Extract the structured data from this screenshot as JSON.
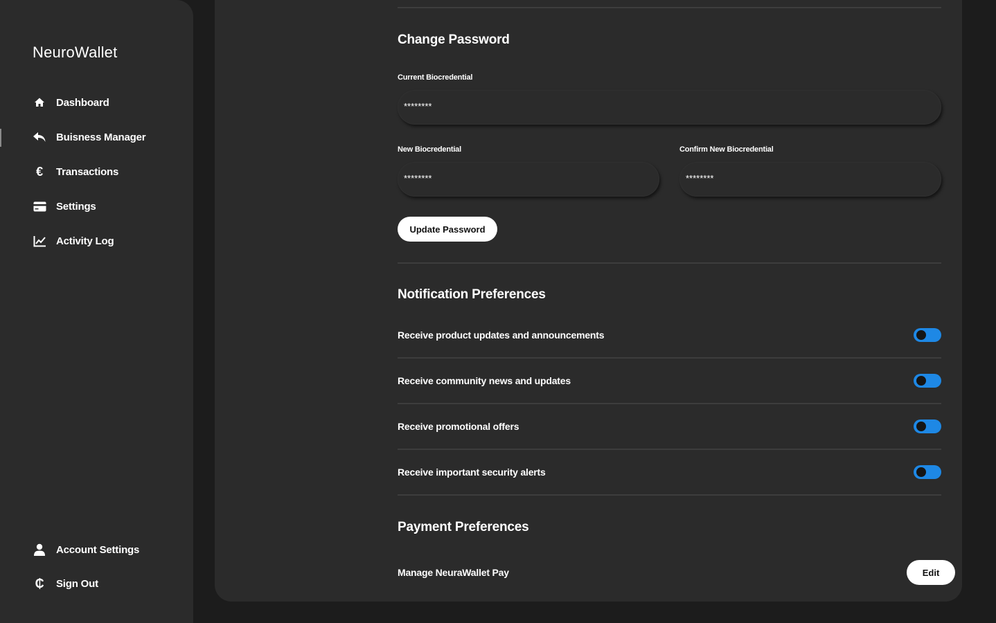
{
  "app": {
    "name": "NeuroWallet"
  },
  "sidebar": {
    "items": [
      {
        "label": "Dashboard",
        "icon": "home-icon"
      },
      {
        "label": "Buisness Manager",
        "icon": "reply-arrow-icon"
      },
      {
        "label": "Transactions",
        "icon": "euro-icon"
      },
      {
        "label": "Settings",
        "icon": "credit-card-icon"
      },
      {
        "label": "Activity Log",
        "icon": "line-chart-icon"
      }
    ],
    "footer": [
      {
        "label": "Account Settings",
        "icon": "user-icon"
      },
      {
        "label": "Sign Out",
        "icon": "cedi-icon"
      }
    ]
  },
  "password": {
    "title": "Change Password",
    "current_label": "Current Biocredential",
    "current_value": "********",
    "new_label": "New Biocredential",
    "new_value": "********",
    "confirm_label": "Confirm New Biocredential",
    "confirm_value": "********",
    "update_button": "Update Password"
  },
  "notifications": {
    "title": "Notification Preferences",
    "items": [
      {
        "label": "Receive product updates and announcements"
      },
      {
        "label": "Receive community news and updates"
      },
      {
        "label": "Receive promotional offers"
      },
      {
        "label": "Receive important security alerts"
      }
    ],
    "toggle_color": "#1e88e5"
  },
  "payment": {
    "title": "Payment Preferences",
    "manage_label": "Manage NeuraWallet Pay",
    "edit_button": "Edit"
  }
}
